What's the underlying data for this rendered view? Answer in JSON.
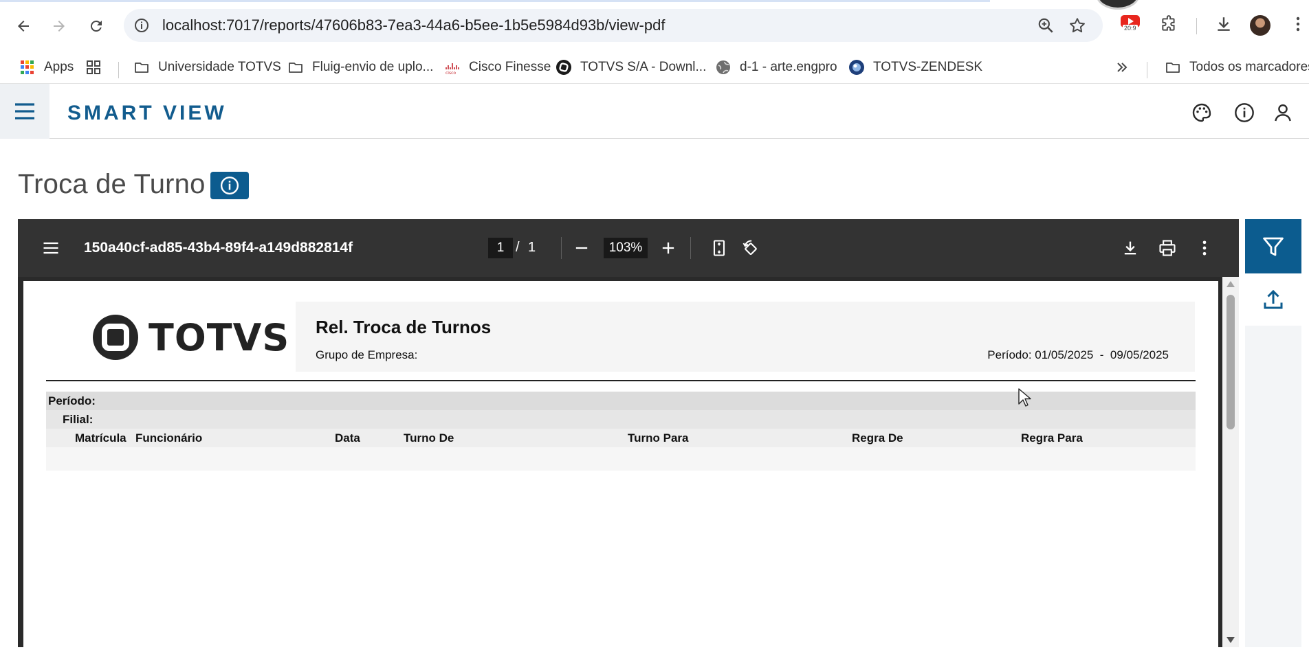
{
  "browser": {
    "url": "localhost:7017/reports/47606b83-7ea3-44a6-b5ee-1b5e5984d93b/view-pdf",
    "extension_badge": "20:9",
    "bookmarks": [
      {
        "label": "Apps",
        "icon": "apps-grid-icon"
      },
      {
        "label": "Universidade TOTVS",
        "icon": "folder-icon"
      },
      {
        "label": "Fluig-envio de uplo...",
        "icon": "folder-icon"
      },
      {
        "label": "Cisco Finesse",
        "icon": "cisco-icon"
      },
      {
        "label": "TOTVS S/A - Downl...",
        "icon": "totvs-icon"
      },
      {
        "label": "d-1 - arte.engpro",
        "icon": "globe-icon"
      },
      {
        "label": "TOTVS-ZENDESK",
        "icon": "zendesk-icon"
      }
    ],
    "all_bookmarks": "Todos os marcadores"
  },
  "app": {
    "brand": "SMART VIEW",
    "page_title": "Troca de Turno"
  },
  "viewer": {
    "doc_name": "150a40cf-ad85-43b4-89f4-a149d882814f",
    "current_page": "1",
    "page_separator": "/",
    "total_pages": "1",
    "zoom": "103%"
  },
  "report": {
    "logo_text": "TOTVS",
    "title": "Rel. Troca de Turnos",
    "group_label": "Grupo de Empresa:",
    "period_text": "Período: 01/05/2025  -  09/05/2025",
    "band_periodo": "Período:",
    "band_filial": "Filial:",
    "columns": [
      "Matrícula",
      "Funcionário",
      "Data",
      "Turno De",
      "Turno Para",
      "Regra De",
      "Regra Para"
    ]
  },
  "colors": {
    "brand": "#125c8e",
    "accent": "#0c5c8f",
    "viewer_toolbar": "#333333"
  }
}
